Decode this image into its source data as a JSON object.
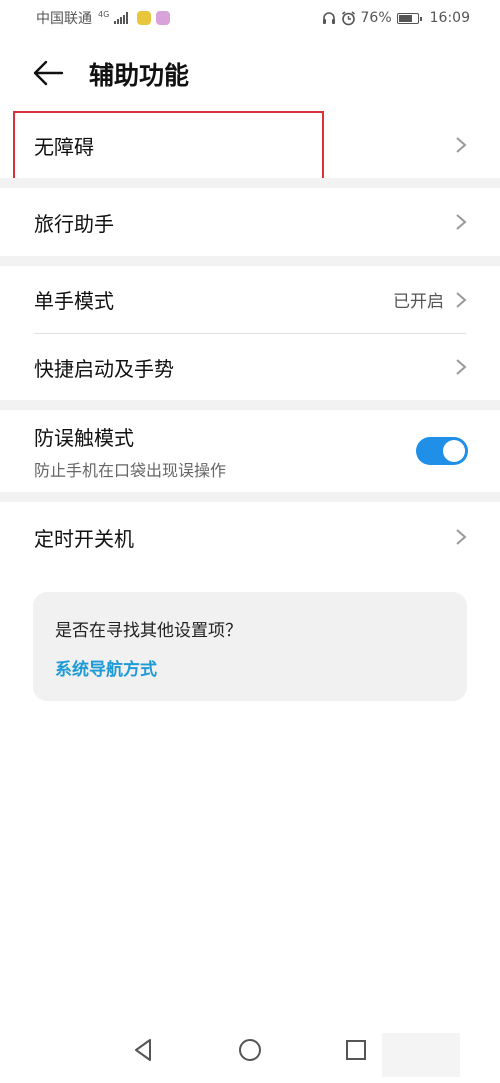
{
  "status_bar": {
    "carrier": "中国联通",
    "network": "4G",
    "battery": "76%",
    "time": "16:09"
  },
  "header": {
    "title": "辅助功能"
  },
  "items": {
    "accessibility": {
      "label": "无障碍"
    },
    "travel": {
      "label": "旅行助手"
    },
    "one_hand": {
      "label": "单手模式",
      "value": "已开启"
    },
    "shortcuts": {
      "label": "快捷启动及手势"
    },
    "pocket_mode": {
      "label": "防误触模式",
      "sublabel": "防止手机在口袋出现误操作",
      "enabled": true
    },
    "scheduled_power": {
      "label": "定时开关机"
    }
  },
  "suggestion_card": {
    "question": "是否在寻找其他设置项？",
    "link": "系统导航方式"
  },
  "colors": {
    "accent": "#1f8fe8",
    "link": "#1e9bd6",
    "highlight": "#d9323a",
    "section_bg": "#f2f2f2"
  },
  "icons": [
    "back-arrow-icon",
    "chevron-right-icon",
    "alarm-icon",
    "headphone-icon",
    "battery-icon",
    "signal-icon",
    "nav-back-icon",
    "nav-home-icon",
    "nav-recents-icon"
  ]
}
